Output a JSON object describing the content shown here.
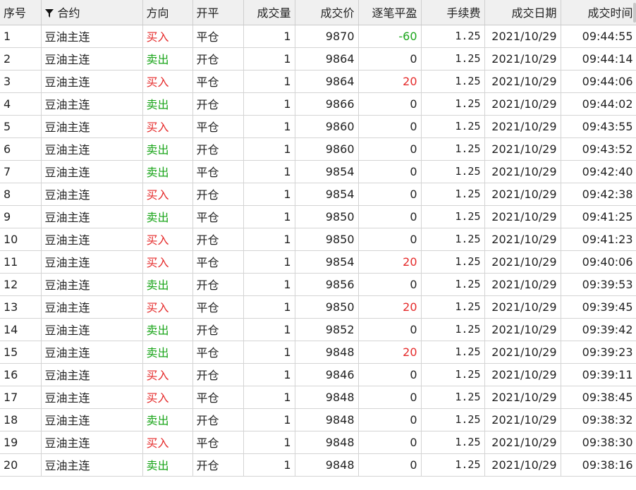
{
  "headers": {
    "seq": "序号",
    "contract": "合约",
    "direction": "方向",
    "openclose": "开平",
    "volume": "成交量",
    "price": "成交价",
    "pnl": "逐笔平盈",
    "fee": "手续费",
    "date": "成交日期",
    "time": "成交时间"
  },
  "icons": {
    "filter": "filter-icon"
  },
  "colors": {
    "buy": "#e52a2a",
    "sell": "#1aa51a"
  },
  "rows": [
    {
      "seq": "1",
      "contract": "豆油主连",
      "direction": "买入",
      "dir": "buy",
      "openclose": "平仓",
      "volume": "1",
      "price": "9870",
      "pnl": "-60",
      "pnl_sign": "neg",
      "fee": "1.25",
      "date": "2021/10/29",
      "time": "09:44:55"
    },
    {
      "seq": "2",
      "contract": "豆油主连",
      "direction": "卖出",
      "dir": "sell",
      "openclose": "开仓",
      "volume": "1",
      "price": "9864",
      "pnl": "0",
      "pnl_sign": "zero",
      "fee": "1.25",
      "date": "2021/10/29",
      "time": "09:44:14"
    },
    {
      "seq": "3",
      "contract": "豆油主连",
      "direction": "买入",
      "dir": "buy",
      "openclose": "平仓",
      "volume": "1",
      "price": "9864",
      "pnl": "20",
      "pnl_sign": "pos",
      "fee": "1.25",
      "date": "2021/10/29",
      "time": "09:44:06"
    },
    {
      "seq": "4",
      "contract": "豆油主连",
      "direction": "卖出",
      "dir": "sell",
      "openclose": "开仓",
      "volume": "1",
      "price": "9866",
      "pnl": "0",
      "pnl_sign": "zero",
      "fee": "1.25",
      "date": "2021/10/29",
      "time": "09:44:02"
    },
    {
      "seq": "5",
      "contract": "豆油主连",
      "direction": "买入",
      "dir": "buy",
      "openclose": "平仓",
      "volume": "1",
      "price": "9860",
      "pnl": "0",
      "pnl_sign": "zero",
      "fee": "1.25",
      "date": "2021/10/29",
      "time": "09:43:55"
    },
    {
      "seq": "6",
      "contract": "豆油主连",
      "direction": "卖出",
      "dir": "sell",
      "openclose": "开仓",
      "volume": "1",
      "price": "9860",
      "pnl": "0",
      "pnl_sign": "zero",
      "fee": "1.25",
      "date": "2021/10/29",
      "time": "09:43:52"
    },
    {
      "seq": "7",
      "contract": "豆油主连",
      "direction": "卖出",
      "dir": "sell",
      "openclose": "平仓",
      "volume": "1",
      "price": "9854",
      "pnl": "0",
      "pnl_sign": "zero",
      "fee": "1.25",
      "date": "2021/10/29",
      "time": "09:42:40"
    },
    {
      "seq": "8",
      "contract": "豆油主连",
      "direction": "买入",
      "dir": "buy",
      "openclose": "开仓",
      "volume": "1",
      "price": "9854",
      "pnl": "0",
      "pnl_sign": "zero",
      "fee": "1.25",
      "date": "2021/10/29",
      "time": "09:42:38"
    },
    {
      "seq": "9",
      "contract": "豆油主连",
      "direction": "卖出",
      "dir": "sell",
      "openclose": "平仓",
      "volume": "1",
      "price": "9850",
      "pnl": "0",
      "pnl_sign": "zero",
      "fee": "1.25",
      "date": "2021/10/29",
      "time": "09:41:25"
    },
    {
      "seq": "10",
      "contract": "豆油主连",
      "direction": "买入",
      "dir": "buy",
      "openclose": "开仓",
      "volume": "1",
      "price": "9850",
      "pnl": "0",
      "pnl_sign": "zero",
      "fee": "1.25",
      "date": "2021/10/29",
      "time": "09:41:23"
    },
    {
      "seq": "11",
      "contract": "豆油主连",
      "direction": "买入",
      "dir": "buy",
      "openclose": "平仓",
      "volume": "1",
      "price": "9854",
      "pnl": "20",
      "pnl_sign": "pos",
      "fee": "1.25",
      "date": "2021/10/29",
      "time": "09:40:06"
    },
    {
      "seq": "12",
      "contract": "豆油主连",
      "direction": "卖出",
      "dir": "sell",
      "openclose": "开仓",
      "volume": "1",
      "price": "9856",
      "pnl": "0",
      "pnl_sign": "zero",
      "fee": "1.25",
      "date": "2021/10/29",
      "time": "09:39:53"
    },
    {
      "seq": "13",
      "contract": "豆油主连",
      "direction": "买入",
      "dir": "buy",
      "openclose": "平仓",
      "volume": "1",
      "price": "9850",
      "pnl": "20",
      "pnl_sign": "pos",
      "fee": "1.25",
      "date": "2021/10/29",
      "time": "09:39:45"
    },
    {
      "seq": "14",
      "contract": "豆油主连",
      "direction": "卖出",
      "dir": "sell",
      "openclose": "开仓",
      "volume": "1",
      "price": "9852",
      "pnl": "0",
      "pnl_sign": "zero",
      "fee": "1.25",
      "date": "2021/10/29",
      "time": "09:39:42"
    },
    {
      "seq": "15",
      "contract": "豆油主连",
      "direction": "卖出",
      "dir": "sell",
      "openclose": "平仓",
      "volume": "1",
      "price": "9848",
      "pnl": "20",
      "pnl_sign": "pos",
      "fee": "1.25",
      "date": "2021/10/29",
      "time": "09:39:23"
    },
    {
      "seq": "16",
      "contract": "豆油主连",
      "direction": "买入",
      "dir": "buy",
      "openclose": "开仓",
      "volume": "1",
      "price": "9846",
      "pnl": "0",
      "pnl_sign": "zero",
      "fee": "1.25",
      "date": "2021/10/29",
      "time": "09:39:11"
    },
    {
      "seq": "17",
      "contract": "豆油主连",
      "direction": "买入",
      "dir": "buy",
      "openclose": "平仓",
      "volume": "1",
      "price": "9848",
      "pnl": "0",
      "pnl_sign": "zero",
      "fee": "1.25",
      "date": "2021/10/29",
      "time": "09:38:45"
    },
    {
      "seq": "18",
      "contract": "豆油主连",
      "direction": "卖出",
      "dir": "sell",
      "openclose": "开仓",
      "volume": "1",
      "price": "9848",
      "pnl": "0",
      "pnl_sign": "zero",
      "fee": "1.25",
      "date": "2021/10/29",
      "time": "09:38:32"
    },
    {
      "seq": "19",
      "contract": "豆油主连",
      "direction": "买入",
      "dir": "buy",
      "openclose": "平仓",
      "volume": "1",
      "price": "9848",
      "pnl": "0",
      "pnl_sign": "zero",
      "fee": "1.25",
      "date": "2021/10/29",
      "time": "09:38:30"
    },
    {
      "seq": "20",
      "contract": "豆油主连",
      "direction": "卖出",
      "dir": "sell",
      "openclose": "开仓",
      "volume": "1",
      "price": "9848",
      "pnl": "0",
      "pnl_sign": "zero",
      "fee": "1.25",
      "date": "2021/10/29",
      "time": "09:38:16"
    }
  ]
}
